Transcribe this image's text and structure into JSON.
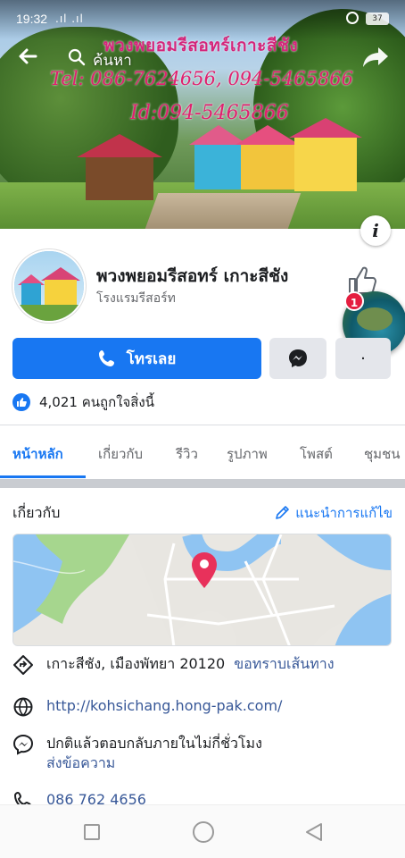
{
  "status_bar": {
    "time": "19:32",
    "signal": ".ıl .ıl",
    "battery": "37"
  },
  "toolbar": {
    "search_label": "ค้นหา"
  },
  "cover": {
    "title": "พวงพยอมรีสอทร์เกาะสีชัง",
    "tel": "Tel: 086-7624656, 094-5465866",
    "line_id": "Id:094-5465866"
  },
  "profile": {
    "page_name": "พวงพยอมรีสอทร์ เกาะสีชัง",
    "category": "โรงแรมรีสอร์ท",
    "notification_count": "1"
  },
  "actions": {
    "call_label": "โทรเลย",
    "more_label": "·"
  },
  "likes": {
    "text": "4,021 คนถูกใจสิ่งนี้"
  },
  "tabs": [
    {
      "label": "หน้าหลัก"
    },
    {
      "label": "เกี่ยวกับ"
    },
    {
      "label": "รีวิว"
    },
    {
      "label": "รูปภาพ"
    },
    {
      "label": "โพสต์"
    },
    {
      "label": "ชุมชน"
    }
  ],
  "about": {
    "title": "เกี่ยวกับ",
    "suggest_edit": "แนะนำการแก้ไข",
    "address": "เกาะสีชัง, เมืองพัทยา 20120",
    "directions": "ขอทราบเส้นทาง",
    "website": "http://kohsichang.hong-pak.com/",
    "response_time": "ปกติแล้วตอบกลับภายในไม่กี่ชั่วโมง",
    "send_message": "ส่งข้อความ",
    "phone": "086 762 4656"
  },
  "colors": {
    "brand_blue": "#1877f2",
    "link_blue": "#385898",
    "map_pin": "#e8315b",
    "badge_red": "#e41e3f"
  }
}
